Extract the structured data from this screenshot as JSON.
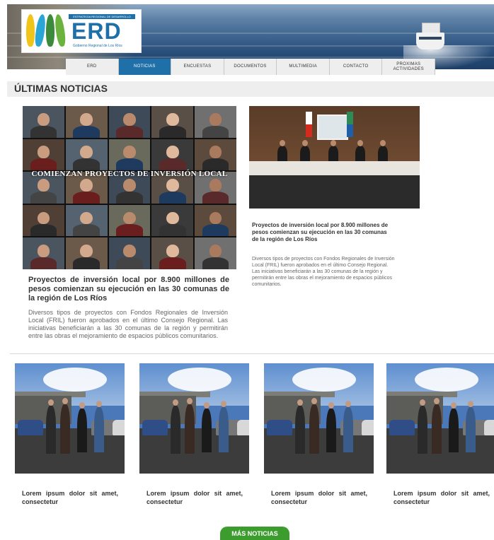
{
  "header": {
    "logo": {
      "strip_text": "ESTRATEGIA REGIONAL DE DESARROLLO",
      "brand": "ERD",
      "subtitle": "Gobierno Regional de Los Ríos"
    }
  },
  "nav": {
    "items": [
      {
        "label": "ERD"
      },
      {
        "label": "NOTICIAS"
      },
      {
        "label": "ENCUESTAS"
      },
      {
        "label": "DOCUMENTOS"
      },
      {
        "label": "MULTIMEDIA"
      },
      {
        "label": "CONTACTO"
      },
      {
        "label": "PROXIMAS ACTIVIDADES"
      }
    ]
  },
  "section_title": "ÚLTIMAS NOTICIAS",
  "featured": {
    "image_caption": "COMIENZAN PROYECTOS DE INVERSIÓN LOCAL",
    "title": "Proyectos de inversión local por 8.900 millones de pesos comienzan su ejecución en las 30 comunas de la región de Los Ríos",
    "description": "Diversos tipos de proyectos con Fondos Regionales de Inversión Local (FRIL) fueron  aprobados en el último Consejo Regional. Las iniciativas beneficiarán a las 30 comunas de la región y permitirán entre las obras el mejoramiento de espacios públicos comunitarios."
  },
  "secondary": {
    "title": "Proyectos de inversión local por 8.900 millones de pesos comienzan su ejecución en las 30 comunas de la región de Los Ríos",
    "description": "Diversos tipos de proyectos con Fondos Regionales de Inversión Local (FRIL) fueron  aprobados en el último Consejo Regional. Las iniciativas beneficiarán a las 30 comunas de la región y permitirán entre las obras el mejoramiento de espacios públicos comunitarios."
  },
  "cards": [
    {
      "caption": "Lorem ipsum dolor sit amet, consectetur"
    },
    {
      "caption": "Lorem ipsum dolor sit amet, consectetur"
    },
    {
      "caption": "Lorem ipsum dolor sit amet, consectetur"
    },
    {
      "caption": "Lorem ipsum dolor sit amet, consectetur"
    }
  ],
  "more_button": "MÁS NOTICIAS",
  "colors": {
    "accent_blue": "#1f6fa9",
    "button_green": "#3c9d2e",
    "nav_bg": "#eeeeee"
  }
}
